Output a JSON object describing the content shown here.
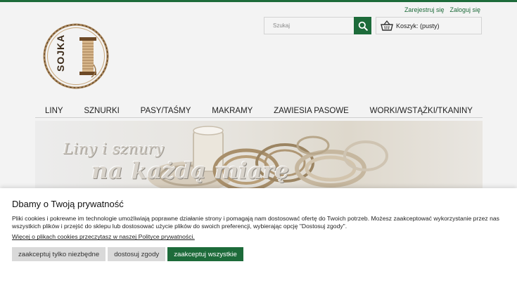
{
  "header": {
    "register_link": "Zarejestruj się",
    "login_link": "Zaloguj się",
    "logo_text": "SOJKA",
    "search_placeholder": "Szukaj",
    "cart_label": "Koszyk: (pusty)"
  },
  "nav": {
    "items": [
      "LINY",
      "SZNURKI",
      "PASY/TAŚMY",
      "MAKRAMY",
      "ZAWIESIA PASOWE",
      "WORKI/WSTĄŻKI/TKANINY"
    ]
  },
  "banner": {
    "line1": "Liny i sznury",
    "line2": "na każdą miarę"
  },
  "cookie": {
    "title": "Dbamy o Twoją prywatność",
    "text": "Pliki cookies i pokrewne im technologie umożliwiają poprawne działanie strony i pomagają nam dostosować ofertę do Twoich potrzeb. Możesz zaakceptować wykorzystanie przez nas wszystkich plików i przejść do sklepu lub dostosować użycie plików do swoich preferencji, wybierając opcję \"Dostosuj zgody\".",
    "policy_link": "Więcej o plikach cookies przeczytasz w naszej Polityce prywatności.",
    "btn_necessary": "zaakceptuj tylko niezbędne",
    "btn_customize": "dostosuj zgody",
    "btn_accept_all": "zaakceptuj wszystkie"
  },
  "colors": {
    "accent": "#1d6b3a"
  }
}
